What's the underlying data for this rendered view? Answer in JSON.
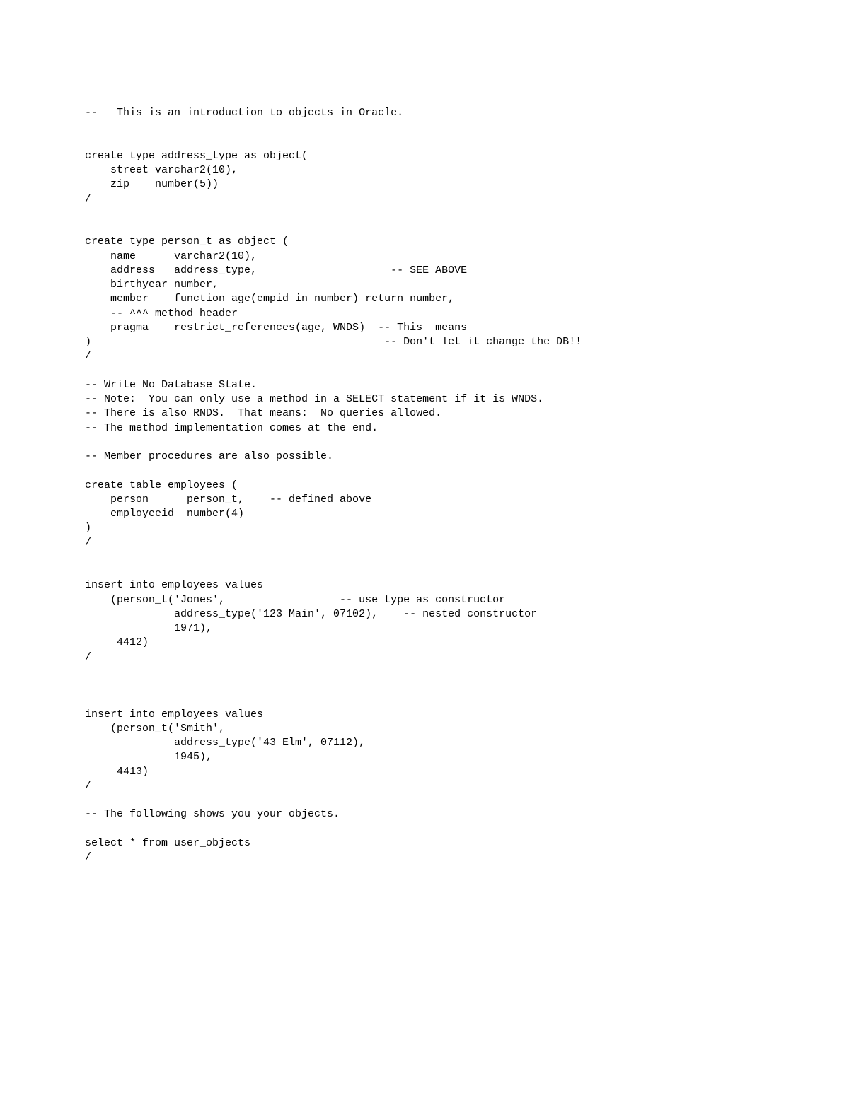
{
  "text": "--   This is an introduction to objects in Oracle.\n\n\ncreate type address_type as object(\n    street varchar2(10),\n    zip    number(5))\n/\n\n\ncreate type person_t as object (\n    name      varchar2(10),\n    address   address_type,                     -- SEE ABOVE\n    birthyear number,\n    member    function age(empid in number) return number,\n    -- ^^^ method header\n    pragma    restrict_references(age, WNDS)  -- This  means\n)                                              -- Don't let it change the DB!!\n/\n\n-- Write No Database State.\n-- Note:  You can only use a method in a SELECT statement if it is WNDS.\n-- There is also RNDS.  That means:  No queries allowed.\n-- The method implementation comes at the end.\n\n-- Member procedures are also possible.\n\ncreate table employees (\n    person      person_t,    -- defined above\n    employeeid  number(4)\n)\n/\n\n\ninsert into employees values\n    (person_t('Jones',                  -- use type as constructor\n              address_type('123 Main', 07102),    -- nested constructor\n              1971),\n     4412)\n/\n\n\n\ninsert into employees values\n    (person_t('Smith',\n              address_type('43 Elm', 07112),\n              1945),\n     4413)\n/\n\n-- The following shows you your objects.\n\nselect * from user_objects\n/"
}
